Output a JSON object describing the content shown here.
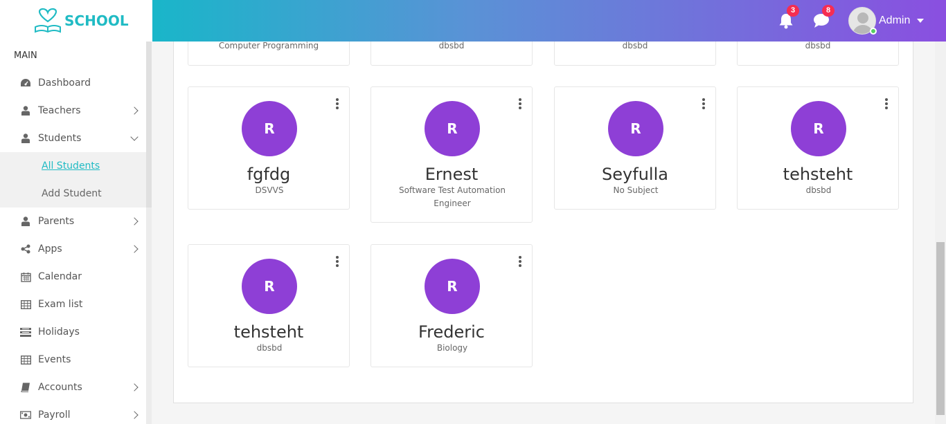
{
  "brand": {
    "name": "SCHOOL",
    "accent": "#20bbc4"
  },
  "header": {
    "notifications_count": "3",
    "messages_count": "8",
    "user_name": "Admin"
  },
  "sidebar": {
    "section_title": "MAIN",
    "items": [
      {
        "label": "Dashboard",
        "icon": "dashboard-icon"
      },
      {
        "label": "Teachers",
        "icon": "user-icon"
      },
      {
        "label": "Students",
        "icon": "user-icon"
      },
      {
        "label": "Parents",
        "icon": "user-icon"
      },
      {
        "label": "Apps",
        "icon": "share-icon"
      },
      {
        "label": "Calendar",
        "icon": "calendar-icon"
      },
      {
        "label": "Exam list",
        "icon": "table-icon"
      },
      {
        "label": "Holidays",
        "icon": "list-icon"
      },
      {
        "label": "Events",
        "icon": "table-icon"
      },
      {
        "label": "Accounts",
        "icon": "book-icon"
      },
      {
        "label": "Payroll",
        "icon": "money-icon"
      }
    ],
    "students_submenu": [
      {
        "label": "All Students",
        "active": true
      },
      {
        "label": "Add Student",
        "active": false
      }
    ]
  },
  "cards_top_row": [
    {
      "subtitle": "Computer Programming"
    },
    {
      "subtitle": "dbsbd"
    },
    {
      "subtitle": "dbsbd"
    },
    {
      "subtitle": "dbsbd"
    }
  ],
  "cards": [
    {
      "initial": "R",
      "name": "fgfdg",
      "subtitle": "DSVVS"
    },
    {
      "initial": "R",
      "name": "Ernest",
      "subtitle": "Software Test Automation Engineer"
    },
    {
      "initial": "R",
      "name": "Seyfulla",
      "subtitle": "No Subject"
    },
    {
      "initial": "R",
      "name": "tehsteht",
      "subtitle": "dbsbd"
    },
    {
      "initial": "R",
      "name": "tehsteht",
      "subtitle": "dbsbd"
    },
    {
      "initial": "R",
      "name": "Frederic",
      "subtitle": "Biology"
    }
  ],
  "colors": {
    "avatar_bg": "#8e3fd6",
    "badge": "#f62d51",
    "header_start": "#19b6c9",
    "header_end": "#8a4fe0"
  }
}
